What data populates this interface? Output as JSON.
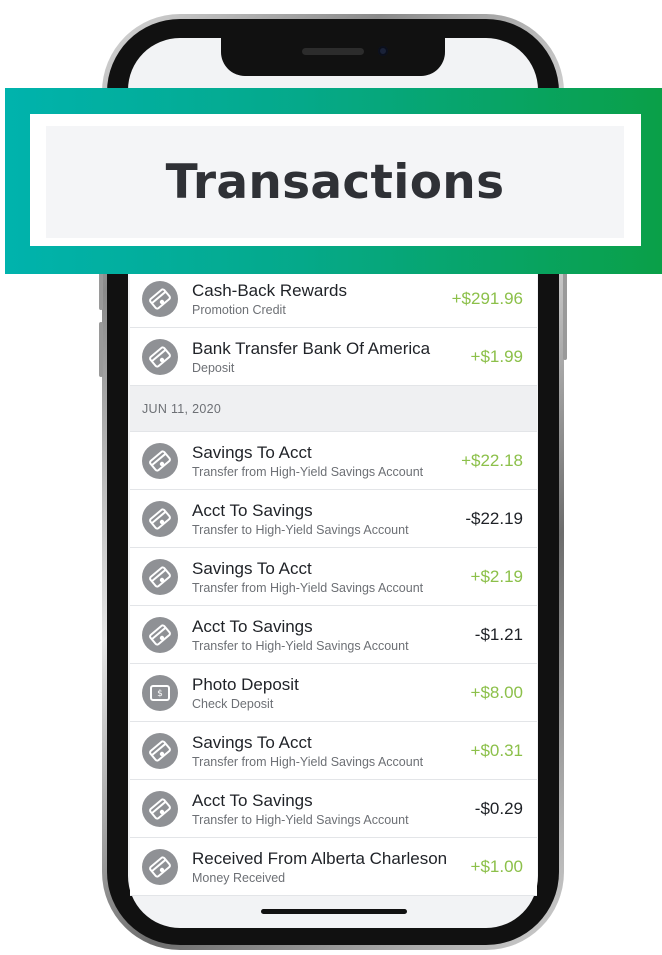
{
  "banner": {
    "title": "Transactions"
  },
  "colors": {
    "positive": "#8cc04a",
    "negative": "#1f2227",
    "banner_start": "#00b3ad",
    "banner_end": "#0aa048"
  },
  "group_top": [
    {
      "name": "Cash-Back Rewards",
      "sub": "Promotion Credit",
      "amount": "+$291.96",
      "icon": "card-icon"
    },
    {
      "name": "Bank Transfer Bank Of America",
      "sub": "Deposit",
      "amount": "+$1.99",
      "icon": "card-icon"
    }
  ],
  "date_header": "JUN 11, 2020",
  "group_jun11": [
    {
      "name": "Savings To Acct",
      "sub": "Transfer from High-Yield Savings Account",
      "amount": "+$22.18",
      "icon": "card-icon"
    },
    {
      "name": "Acct To Savings",
      "sub": "Transfer to High-Yield Savings Account",
      "amount": "-$22.19",
      "icon": "card-icon"
    },
    {
      "name": "Savings To Acct",
      "sub": "Transfer from High-Yield Savings Account",
      "amount": "+$2.19",
      "icon": "card-icon"
    },
    {
      "name": "Acct To Savings",
      "sub": "Transfer to High-Yield Savings Account",
      "amount": "-$1.21",
      "icon": "card-icon"
    },
    {
      "name": "Photo Deposit",
      "sub": "Check Deposit",
      "amount": "+$8.00",
      "icon": "check-icon"
    },
    {
      "name": "Savings To Acct",
      "sub": "Transfer from High-Yield Savings Account",
      "amount": "+$0.31",
      "icon": "card-icon"
    },
    {
      "name": "Acct To Savings",
      "sub": "Transfer to High-Yield Savings Account",
      "amount": "-$0.29",
      "icon": "card-icon"
    },
    {
      "name": "Received From Alberta Charleson",
      "sub": "Money Received",
      "amount": "+$1.00",
      "icon": "card-icon"
    }
  ]
}
